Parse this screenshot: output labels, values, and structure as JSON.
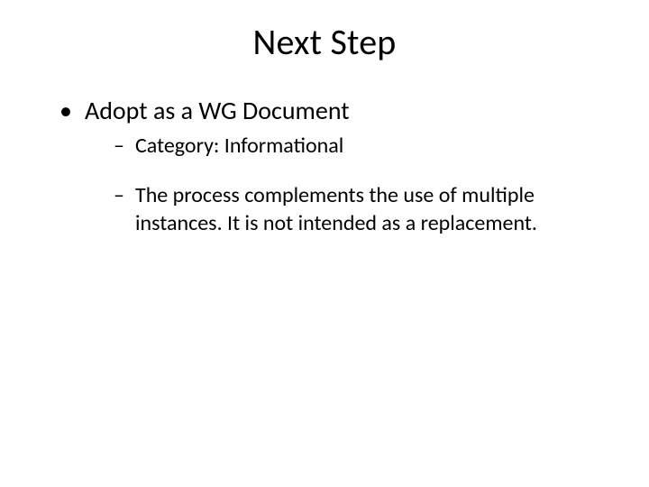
{
  "title": "Next Step",
  "bullets": [
    {
      "text": "Adopt as a WG Document",
      "children": [
        {
          "text": "Category: Informational"
        },
        {
          "text": "The process complements the use of multiple instances.  It is not intended as a replacement."
        }
      ]
    }
  ]
}
